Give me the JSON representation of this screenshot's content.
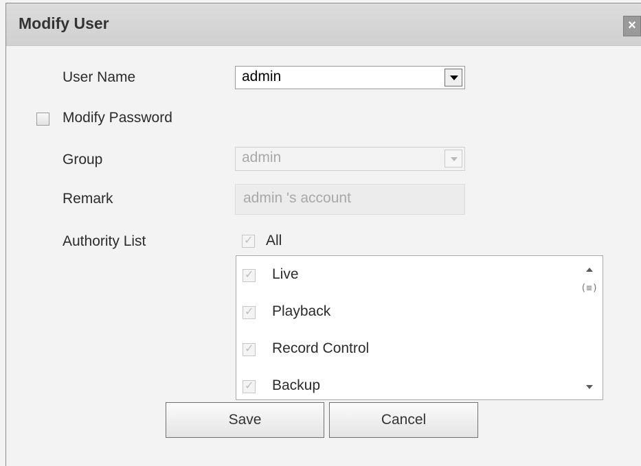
{
  "dialog": {
    "title": "Modify User",
    "close_label": "×"
  },
  "form": {
    "user_name_label": "User Name",
    "user_name_value": "admin",
    "modify_password_label": "Modify Password",
    "modify_password_checked": false,
    "group_label": "Group",
    "group_value": "admin",
    "remark_label": "Remark",
    "remark_value": "admin 's account",
    "authority_label": "Authority List",
    "all_label": "All",
    "all_checked": true
  },
  "authority_items": [
    {
      "label": "Live",
      "checked": true
    },
    {
      "label": "Playback",
      "checked": true
    },
    {
      "label": "Record Control",
      "checked": true
    },
    {
      "label": "Backup",
      "checked": true
    }
  ],
  "scrollbar": {
    "thumb_glyph": "(≡)"
  },
  "buttons": {
    "save_label": "Save",
    "cancel_label": "Cancel"
  }
}
